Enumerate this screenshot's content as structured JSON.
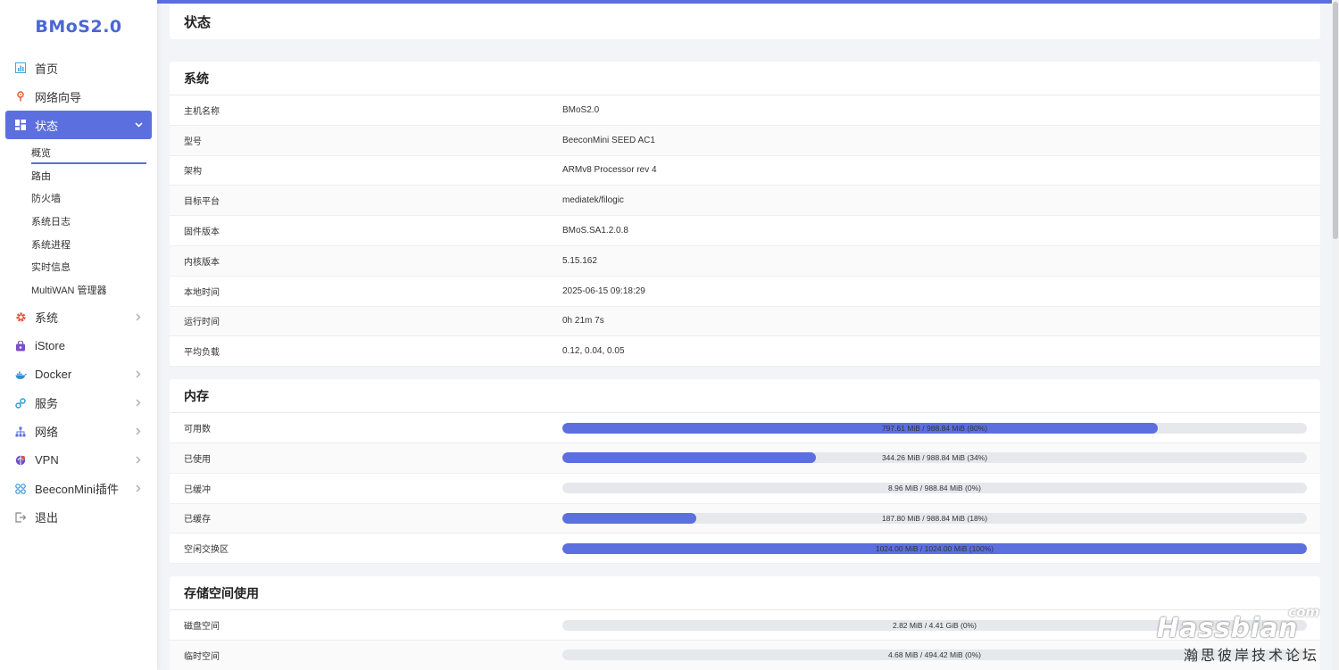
{
  "brand": "BMoS2.0",
  "colors": {
    "accent": "#5b6fdf",
    "brand": "#4a67d6"
  },
  "sidebar": {
    "items": [
      {
        "label": "首页",
        "icon": "dashboard-icon",
        "has_arrow": false
      },
      {
        "label": "网络向导",
        "icon": "wizard-icon",
        "has_arrow": false
      },
      {
        "label": "状态",
        "icon": "grid-icon",
        "has_arrow": true,
        "active": true,
        "children": [
          "概览",
          "路由",
          "防火墙",
          "系统日志",
          "系统进程",
          "实时信息",
          "MultiWAN 管理器"
        ]
      },
      {
        "label": "系统",
        "icon": "gear-icon",
        "has_arrow": true
      },
      {
        "label": "iStore",
        "icon": "store-icon",
        "has_arrow": false
      },
      {
        "label": "Docker",
        "icon": "docker-icon",
        "has_arrow": true
      },
      {
        "label": "服务",
        "icon": "services-icon",
        "has_arrow": true
      },
      {
        "label": "网络",
        "icon": "network-icon",
        "has_arrow": true
      },
      {
        "label": "VPN",
        "icon": "vpn-icon",
        "has_arrow": true
      },
      {
        "label": "BeeconMini插件",
        "icon": "plugins-icon",
        "has_arrow": true
      },
      {
        "label": "退出",
        "icon": "logout-icon",
        "has_arrow": false
      }
    ]
  },
  "page_title": "状态",
  "system": {
    "title": "系统",
    "rows": [
      {
        "label": "主机名称",
        "value": "BMoS2.0"
      },
      {
        "label": "型号",
        "value": "BeeconMini SEED AC1"
      },
      {
        "label": "架构",
        "value": "ARMv8 Processor rev 4"
      },
      {
        "label": "目标平台",
        "value": "mediatek/filogic"
      },
      {
        "label": "固件版本",
        "value": "BMoS.SA1.2.0.8"
      },
      {
        "label": "内核版本",
        "value": "5.15.162"
      },
      {
        "label": "本地时间",
        "value": "2025-06-15 09:18:29"
      },
      {
        "label": "运行时间",
        "value": "0h 21m 7s"
      },
      {
        "label": "平均负载",
        "value": "0.12, 0.04, 0.05"
      }
    ]
  },
  "memory": {
    "title": "内存",
    "rows": [
      {
        "label": "可用数",
        "text": "797.61 MiB / 988.84 MiB (80%)",
        "percent": 80
      },
      {
        "label": "已使用",
        "text": "344.26 MiB / 988.84 MiB (34%)",
        "percent": 34
      },
      {
        "label": "已缓冲",
        "text": "8.96 MiB / 988.84 MiB (0%)",
        "percent": 0
      },
      {
        "label": "已缓存",
        "text": "187.80 MiB / 988.84 MiB (18%)",
        "percent": 18
      },
      {
        "label": "空闲交换区",
        "text": "1024.00 MiB / 1024.00 MiB (100%)",
        "percent": 100
      }
    ]
  },
  "storage": {
    "title": "存储空间使用",
    "rows": [
      {
        "label": "磁盘空间",
        "text": "2.82 MiB / 4.41 GiB (0%)",
        "percent": 0
      },
      {
        "label": "临时空间",
        "text": "4.68 MiB / 494.42 MiB (0%)",
        "percent": 0
      }
    ]
  },
  "watermark": {
    "main": "Hassbian",
    "com": "com",
    "sub": "瀚思彼岸技术论坛"
  }
}
